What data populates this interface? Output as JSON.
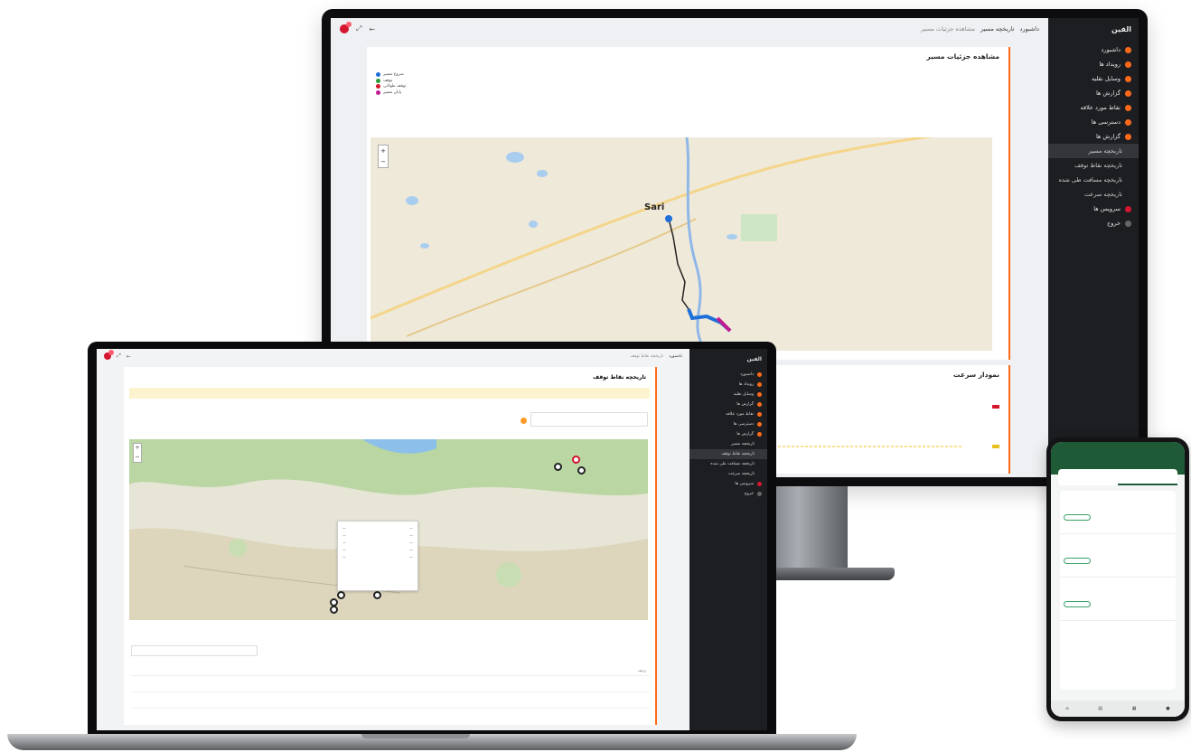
{
  "desktop": {
    "sidebar": {
      "brand": "الفين",
      "brand_sub": "",
      "items": [
        {
          "label": "داشبورد"
        },
        {
          "label": "رویداد ها"
        },
        {
          "label": "وسایل نقلیه"
        },
        {
          "label": "گزارش ها"
        },
        {
          "label": "نقاط مورد علاقه"
        },
        {
          "label": "دسترسی ها"
        },
        {
          "label": "گزارش ها"
        }
      ],
      "sub_items": [
        {
          "label": "تاریخچه مسیر"
        },
        {
          "label": "تاریخچه نقاط توقف"
        },
        {
          "label": "تاریخچه مسافت طی شده"
        },
        {
          "label": "تاریخچه سرعت"
        }
      ],
      "bottom_items": [
        {
          "label": "سرویس ها"
        },
        {
          "label": "خروج"
        }
      ]
    },
    "breadcrumb": {
      "home": "داشبورد",
      "section": "تاریخچه مسیر",
      "current": "مشاهده جزئیات مسیر"
    },
    "route_card": {
      "title": "مشاهده جزئیات مسیر"
    },
    "legend": [
      {
        "label": "شروع مسیر",
        "color": "#1e6fd9"
      },
      {
        "label": "توقف",
        "color": "#2b9c3a"
      },
      {
        "label": "توقف طولانی",
        "color": "#d4162f"
      },
      {
        "label": "پایان مسیر",
        "color": "#c21a8f"
      }
    ],
    "map_labels": {
      "city": "Sari"
    },
    "speed_card": {
      "title": "نمودار سرعت",
      "chip_red": "",
      "chip_yellow": ""
    }
  },
  "laptop": {
    "sidebar": {
      "brand": "الفين",
      "items": [
        {
          "label": "داشبورد"
        },
        {
          "label": "رویداد ها"
        },
        {
          "label": "وسایل نقلیه"
        },
        {
          "label": "گزارش ها"
        },
        {
          "label": "نقاط مورد علاقه"
        },
        {
          "label": "دسترسی ها"
        },
        {
          "label": "گزارش ها"
        }
      ],
      "sub_items": [
        {
          "label": "تاریخچه مسیر"
        },
        {
          "label": "تاریخچه نقاط توقف"
        },
        {
          "label": "تاریخچه مسافت طی شده"
        },
        {
          "label": "تاریخچه سرعت"
        }
      ],
      "bottom_items": [
        {
          "label": "سرویس ها"
        },
        {
          "label": "خروج"
        }
      ],
      "footer": ""
    },
    "breadcrumb": {
      "home": "داشبورد",
      "current": "تاریخچه نقاط توقف"
    },
    "card": {
      "title": "تاریخچه نقاط توقف"
    },
    "warning": "",
    "date_label": "",
    "date_value": "",
    "table": {
      "headers": [
        "ردیف",
        "",
        "",
        "",
        ""
      ],
      "rows": []
    }
  },
  "phone": {
    "header_title": "",
    "tabs": [
      "",
      ""
    ]
  }
}
